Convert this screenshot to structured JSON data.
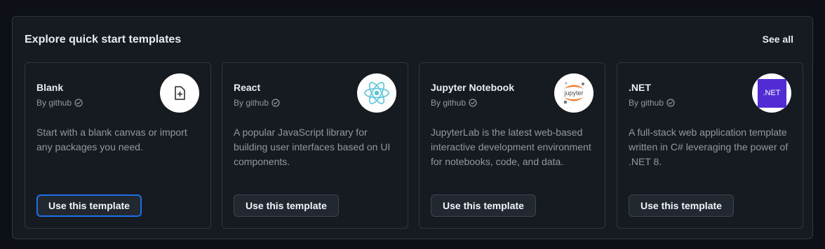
{
  "section": {
    "title": "Explore quick start templates",
    "see_all": "See all"
  },
  "templates": [
    {
      "name": "Blank",
      "author": "By github",
      "description": "Start with a blank canvas or import any packages you need.",
      "button": "Use this template",
      "icon": "file-plus-icon"
    },
    {
      "name": "React",
      "author": "By github",
      "description": "A popular JavaScript library for building user interfaces based on UI components.",
      "button": "Use this template",
      "icon": "react-logo-icon"
    },
    {
      "name": "Jupyter Notebook",
      "author": "By github",
      "description": "JupyterLab is the latest web-based interactive development environment for notebooks, code, and data.",
      "button": "Use this template",
      "icon": "jupyter-logo-icon",
      "logo_text": "jupyter"
    },
    {
      "name": ".NET",
      "author": "By github",
      "description": "A full-stack web application template written in C# leveraging the power of .NET 8.",
      "button": "Use this template",
      "icon": "dotnet-logo-icon",
      "logo_text": ".NET"
    }
  ],
  "colors": {
    "background": "#0d1117",
    "panel": "#161b22",
    "border": "#30363d",
    "focus_ring": "#1f6feb",
    "react": "#58c4dc",
    "jupyter_orange": "#f37726",
    "dotnet_purple": "#512bd4"
  }
}
